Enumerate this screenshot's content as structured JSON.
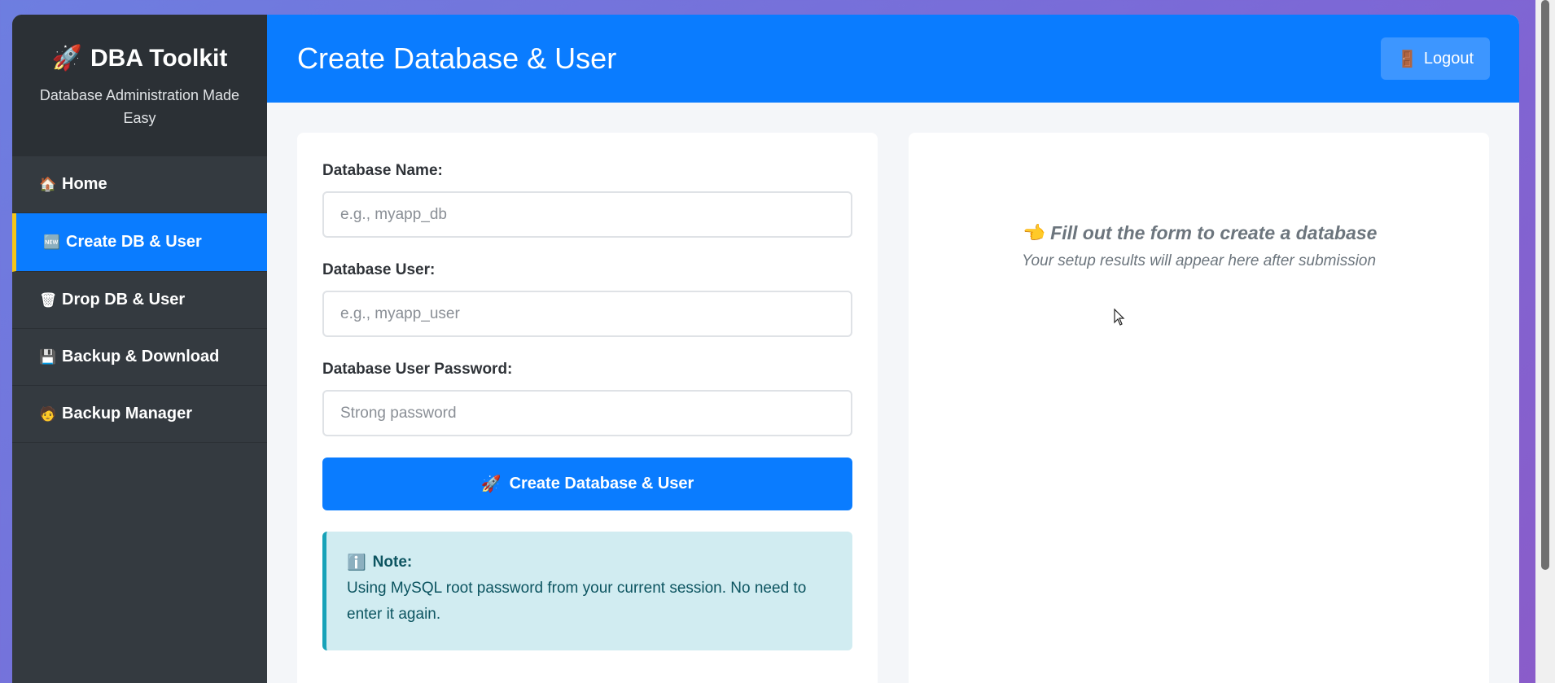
{
  "sidebar": {
    "brand_icon": "rocket-icon",
    "brand_title": "DBA Toolkit",
    "brand_subtitle": "Database Administration Made Easy",
    "items": [
      {
        "label": "Home",
        "icon": "house-icon",
        "glyph": "🏠",
        "active": false
      },
      {
        "label": "Create DB & User",
        "icon": "new-icon",
        "glyph": "🆕",
        "active": true
      },
      {
        "label": "Drop DB & User",
        "icon": "trash-icon",
        "glyph": "🗑",
        "active": false
      },
      {
        "label": "Backup & Download",
        "icon": "floppy-disk-icon",
        "glyph": "💾",
        "active": false
      },
      {
        "label": "Backup Manager",
        "icon": "manager-icon",
        "glyph": "🧑",
        "active": false
      }
    ]
  },
  "header": {
    "title": "Create Database & User",
    "logout_label": "Logout",
    "logout_icon": "door-icon"
  },
  "form": {
    "db_name_label": "Database Name:",
    "db_name_placeholder": "e.g., myapp_db",
    "db_name_value": "",
    "db_user_label": "Database User:",
    "db_user_placeholder": "e.g., myapp_user",
    "db_user_value": "",
    "db_password_label": "Database User Password:",
    "db_password_placeholder": "Strong password",
    "db_password_value": "",
    "submit_label": "Create Database & User",
    "submit_icon": "rocket-icon"
  },
  "note": {
    "icon": "info-icon",
    "title": "Note:",
    "text": "Using MySQL root password from your current session. No need to enter it again."
  },
  "result": {
    "icon": "pointing-hand-icon",
    "title": "Fill out the form to create a database",
    "subtitle": "Your setup results will appear here after submission"
  },
  "colors": {
    "primary": "#0a7cff",
    "sidebar_bg": "#343a40",
    "active_accent": "#f5c518",
    "note_bg": "#d1ecf1",
    "note_border": "#17a2b8"
  }
}
